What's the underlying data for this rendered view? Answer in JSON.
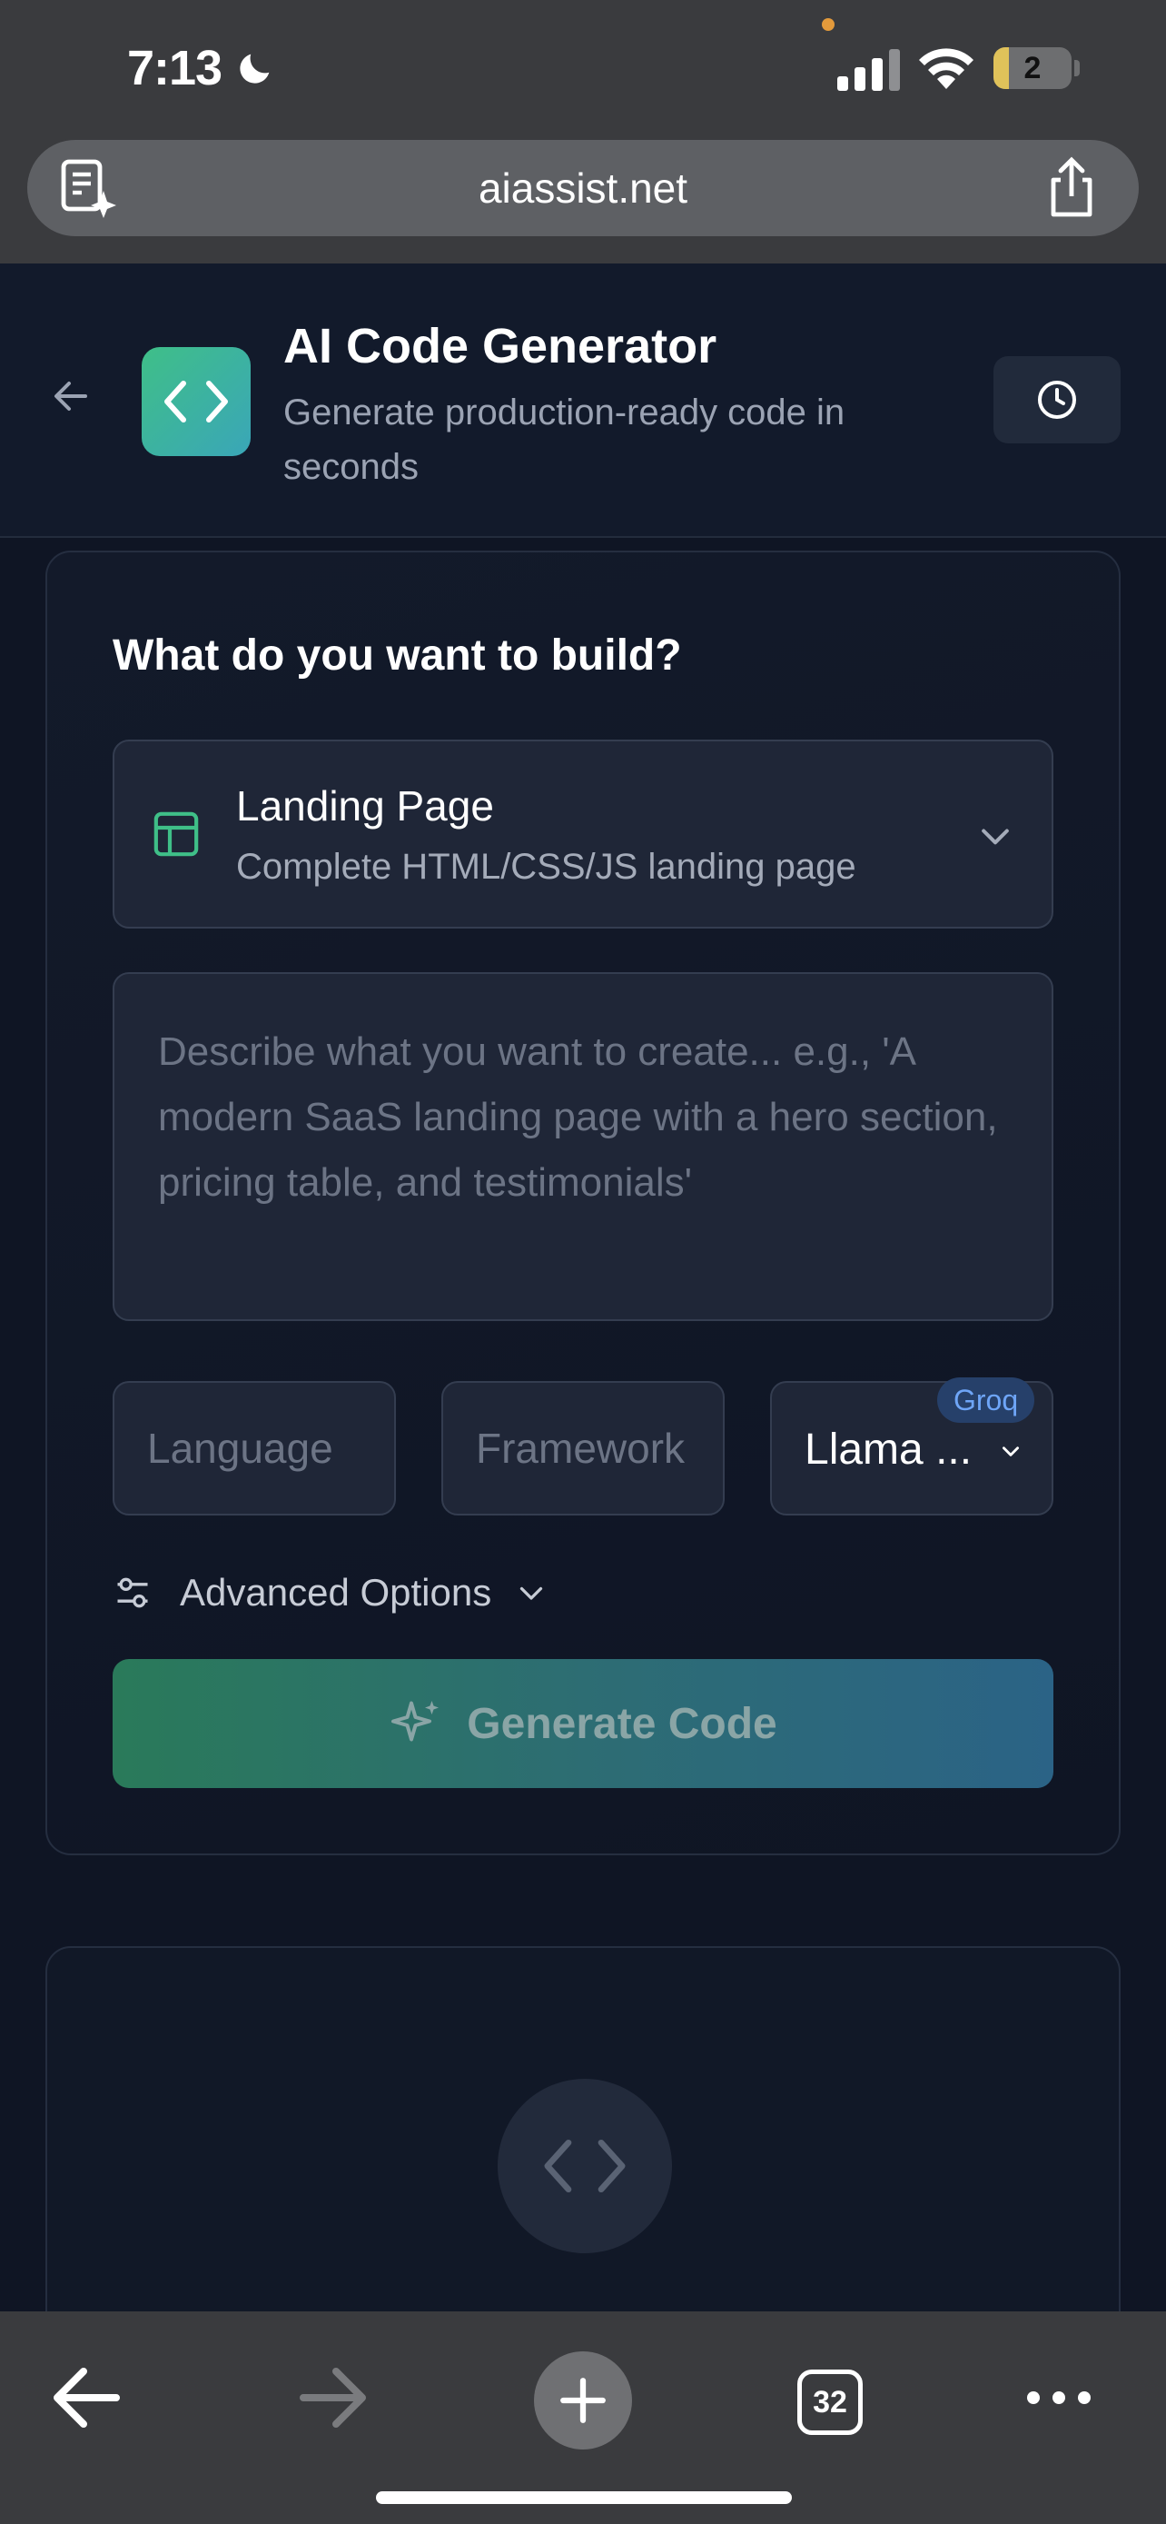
{
  "status_bar": {
    "time": "7:13",
    "battery_label": "2",
    "battery_level": 0.2
  },
  "browser": {
    "url": "aiassist.net",
    "open_tabs": "32"
  },
  "header": {
    "title": "AI Code Generator",
    "subtitle": "Generate production-ready code in seconds"
  },
  "form": {
    "heading": "What do you want to build?",
    "project_type": {
      "label": "Landing Page",
      "description": "Complete HTML/CSS/JS landing page"
    },
    "prompt_placeholder": "Describe what you want to create... e.g., 'A modern SaaS landing page with a hero section, pricing table, and testimonials'",
    "language_placeholder": "Language",
    "framework_placeholder": "Framework",
    "model": {
      "value": "Llama ...",
      "badge": "Groq"
    },
    "advanced_label": "Advanced Options",
    "generate_label": "Generate Code"
  },
  "colors": {
    "accent_green": "#3fbf88",
    "accent_teal": "#3aa6b8",
    "badge_blue": "#6ea5f7",
    "background": "#0f1524"
  }
}
